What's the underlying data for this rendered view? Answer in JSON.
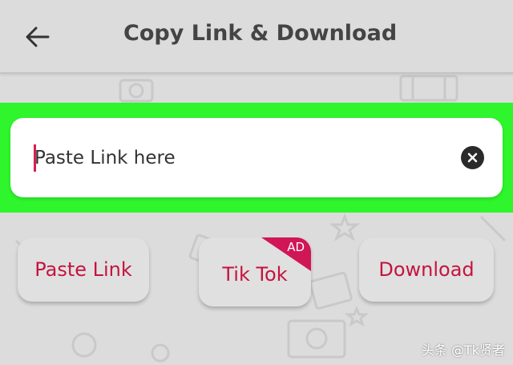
{
  "header": {
    "title": "Copy Link & Download",
    "back_icon": "arrow-left-icon"
  },
  "link_input": {
    "placeholder": "Paste Link here",
    "value": "",
    "clear_icon": "close-circle-icon"
  },
  "actions": {
    "paste_label": "Paste Link",
    "tiktok_label": "Tik Tok",
    "tiktok_badge": "AD",
    "download_label": "Download"
  },
  "watermark": "头条 @Tk贤者",
  "colors": {
    "background": "#dcdcdc",
    "highlight": "#2ff52c",
    "accent": "#c4143f",
    "ad_badge": "#d01656",
    "title_text": "#444444"
  }
}
